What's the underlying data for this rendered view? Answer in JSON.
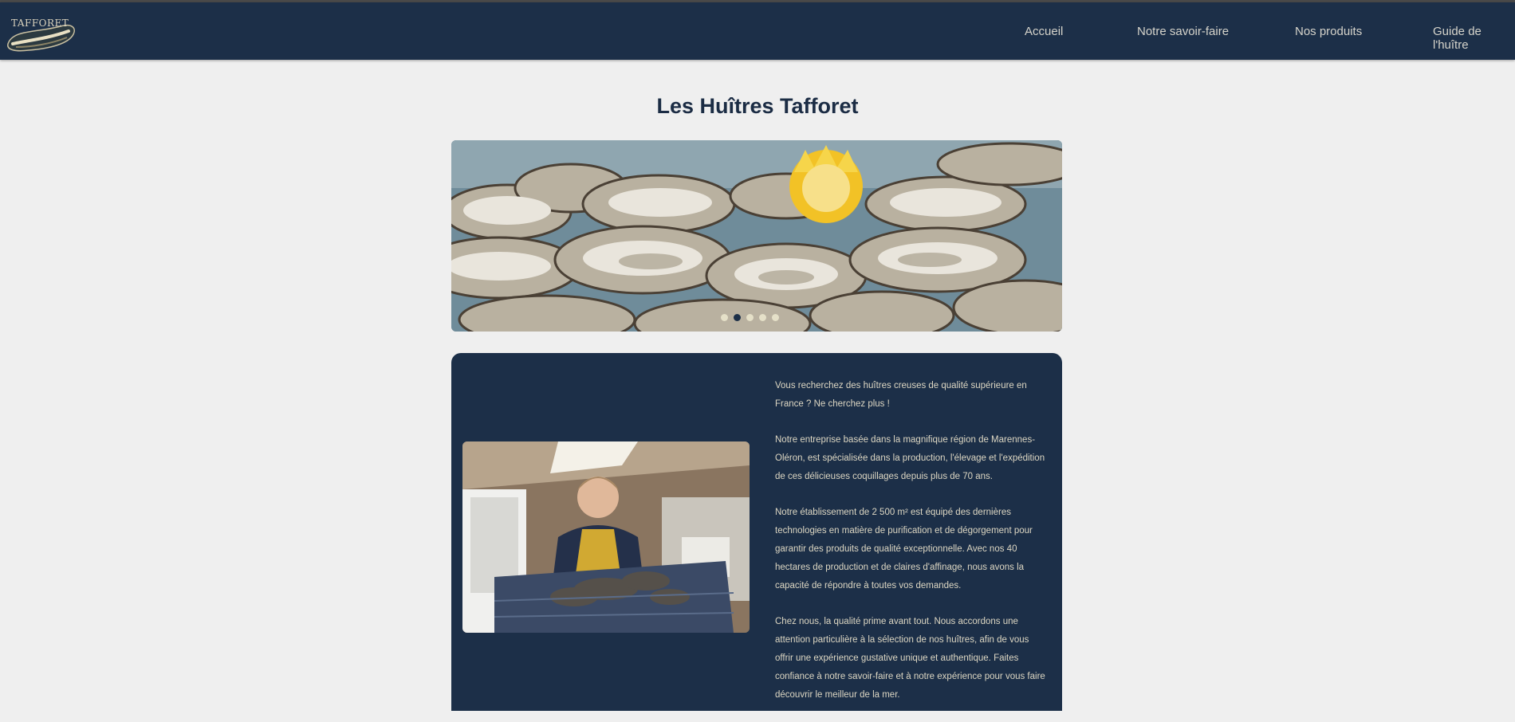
{
  "brand": {
    "logo_text": "TAFFORET"
  },
  "nav": {
    "items": [
      {
        "label": "Accueil"
      },
      {
        "label": "Notre savoir-faire"
      },
      {
        "label": "Nos produits"
      },
      {
        "label": "Guide de l'huître"
      }
    ]
  },
  "main": {
    "title": "Les Huîtres Tafforet",
    "carousel": {
      "slide_count": 5,
      "active_index": 1
    },
    "intro": {
      "paragraphs": [
        "Vous recherchez des huîtres creuses de qualité supérieure en France ? Ne cherchez plus !",
        "Notre entreprise basée dans la magnifique région de Marennes-Oléron, est spécialisée dans la production, l'élevage et l'expédition de ces délicieuses coquillages depuis plus de 70 ans.",
        "Notre établissement de 2 500 m² est équipé des dernières technologies en matière de purification et de dégorgement pour garantir des produits de qualité exceptionnelle. Avec nos 40 hectares de production et de claires d'affinage, nous avons la capacité de répondre à toutes vos demandes.",
        "Chez nous, la qualité prime avant tout. Nous accordons une attention particulière à la sélection de nos huîtres, afin de vous offrir une expérience gustative unique et authentique. Faites confiance à notre savoir-faire et à notre expérience pour vous faire découvrir le meilleur de la mer."
      ]
    }
  },
  "colors": {
    "navy": "#1c2f48",
    "background": "#efefef",
    "nav_text": "#d6d4cb",
    "lemon": "#f2c226"
  }
}
